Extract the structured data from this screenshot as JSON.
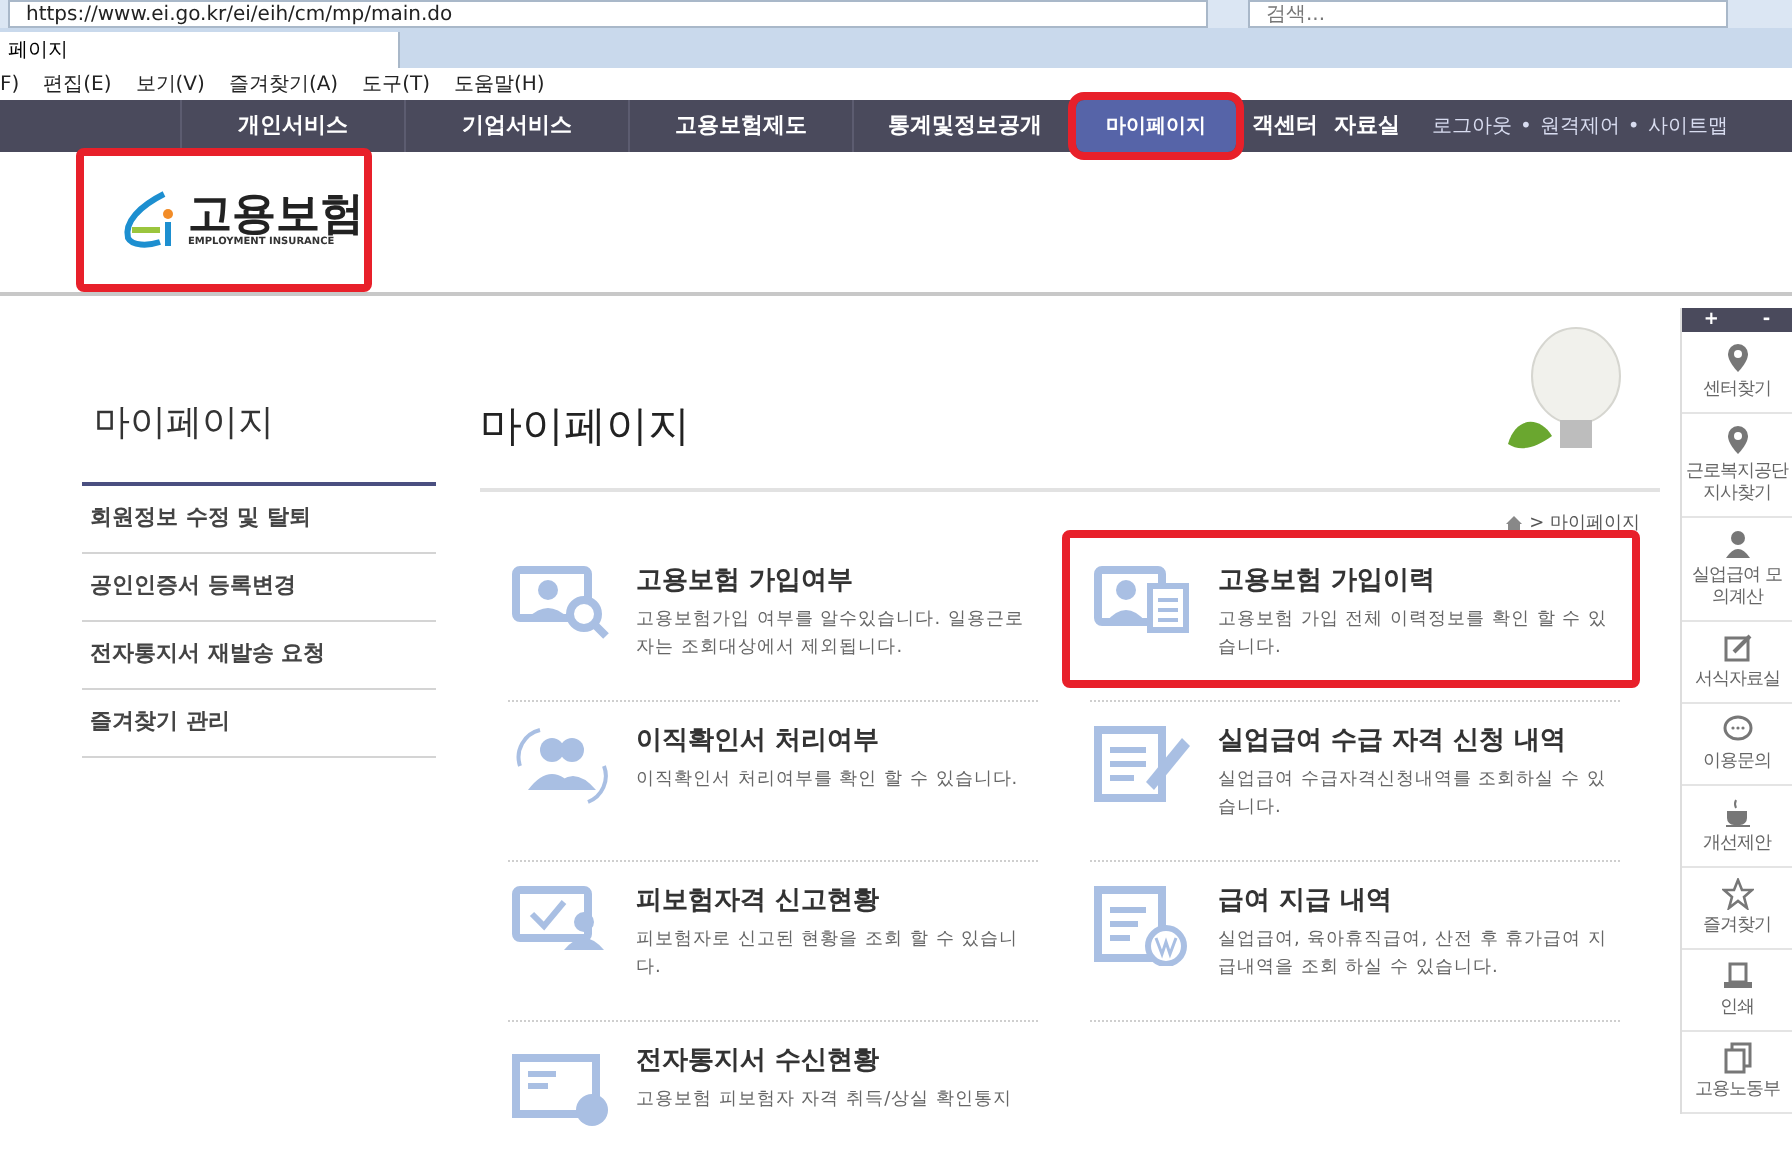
{
  "browser": {
    "url": "https://www.ei.go.kr/ei/eih/cm/mp/main.do",
    "search_placeholder": "검색...",
    "tab_title": "페이지",
    "menu": [
      "F)",
      "편집(E)",
      "보기(V)",
      "즐겨찾기(A)",
      "도구(T)",
      "도움말(H)"
    ]
  },
  "nav": {
    "items": [
      {
        "label": "개인서비스",
        "selected": false,
        "highlighted": false
      },
      {
        "label": "기업서비스",
        "selected": false,
        "highlighted": false
      },
      {
        "label": "고용보험제도",
        "selected": false,
        "highlighted": false
      },
      {
        "label": "통계및정보공개",
        "selected": false,
        "highlighted": false
      },
      {
        "label": "마이페이지",
        "selected": true,
        "highlighted": true
      }
    ],
    "links": [
      "객센터",
      "자료실"
    ],
    "utility": [
      "로그아웃",
      "원격제어",
      "사이트맵"
    ],
    "utility_separator": "•"
  },
  "logo": {
    "title": "고용보험",
    "subtitle": "EMPLOYMENT INSURANCE",
    "highlighted": true
  },
  "sidebar": {
    "title": "마이페이지",
    "items": [
      "회원정보 수정 및 탈퇴",
      "공인인증서 등록변경",
      "전자통지서 재발송 요청",
      "즐겨찾기 관리"
    ]
  },
  "content": {
    "title": "마이페이지",
    "breadcrumb": "> 마이페이지",
    "cards": [
      {
        "kind": "search",
        "title": "고용보험 가입여부",
        "desc": "고용보험가입 여부를 알수있습니다. 일용근로자는 조회대상에서 제외됩니다.",
        "highlighted": false
      },
      {
        "kind": "document",
        "title": "고용보험 가입이력",
        "desc": "고용보험 가입 전체 이력정보를 확인 할 수 있습니다.",
        "highlighted": true
      },
      {
        "kind": "people",
        "title": "이직확인서 처리여부",
        "desc": "이직확인서 처리여부를 확인 할 수 있습니다.",
        "highlighted": false
      },
      {
        "kind": "edit",
        "title": "실업급여 수급 자격 신청 내역",
        "desc": "실업급여 수급자격신청내역를 조회하실 수 있습니다.",
        "highlighted": false
      },
      {
        "kind": "check",
        "title": "피보험자격 신고현황",
        "desc": "피보험자로 신고된 현황을 조회 할 수 있습니다.",
        "highlighted": false
      },
      {
        "kind": "won",
        "title": "급여 지급 내역",
        "desc": "실업급여, 육아휴직급여, 산전 후 휴가급여 지급내역을 조회 하실 수 있습니다.",
        "highlighted": false
      },
      {
        "kind": "mail",
        "title": "전자통지서 수신현황",
        "desc": "고용보험 피보험자 자격 취득/상실 확인통지",
        "highlighted": false
      }
    ]
  },
  "quick_menu": {
    "controls": [
      "+",
      "-"
    ],
    "items": [
      {
        "kind": "pin",
        "label": "센터찾기"
      },
      {
        "kind": "pin",
        "label": "근로복지공단 지사찾기"
      },
      {
        "kind": "person",
        "label": "실업급여 모의계산"
      },
      {
        "kind": "edit",
        "label": "서식자료실"
      },
      {
        "kind": "chat",
        "label": "이용문의"
      },
      {
        "kind": "cup",
        "label": "개선제안"
      },
      {
        "kind": "star",
        "label": "즐겨찾기"
      },
      {
        "kind": "print",
        "label": "인쇄"
      },
      {
        "kind": "copy",
        "label": "고용노동부"
      }
    ]
  }
}
